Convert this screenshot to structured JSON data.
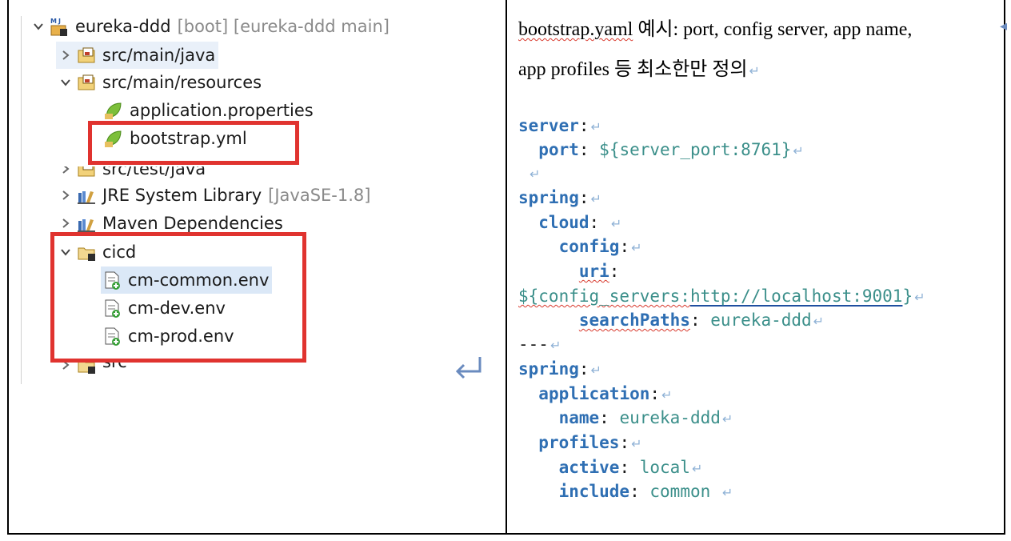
{
  "tree": {
    "items": [
      {
        "label": "eureka-ddd",
        "suffix": "[boot] [eureka-ddd main]",
        "expanded": true
      },
      {
        "label": "src/main/java",
        "expanded": false
      },
      {
        "label": "src/main/resources",
        "expanded": true
      },
      {
        "label": "application.properties"
      },
      {
        "label": "bootstrap.yml"
      },
      {
        "label": "src/test/java",
        "expanded": false
      },
      {
        "label": "JRE System Library",
        "suffix": "[JavaSE-1.8]",
        "expanded": false
      },
      {
        "label": "Maven Dependencies",
        "expanded": false
      },
      {
        "label": "cicd",
        "expanded": true
      },
      {
        "label": "cm-common.env",
        "selected": true
      },
      {
        "label": "cm-dev.env"
      },
      {
        "label": "cm-prod.env"
      },
      {
        "label": "src",
        "expanded": false
      }
    ]
  },
  "doc": {
    "line1_file": "bootstrap.yaml",
    "line1_rest": " 예시: port, config server, app name,",
    "line2": "app profiles 등 최소한만 정의",
    "mark": "↵"
  },
  "code": {
    "k_server": "server",
    "k_port": "port",
    "v_port": "${server_port:8761}",
    "k_spring": "spring",
    "k_cloud": "cloud",
    "k_config": "config",
    "k_uri": "uri",
    "v_uri_prefix": "${config_servers:",
    "v_uri_link": "http://localhost:9001",
    "v_uri_suffix": "}",
    "k_searchpaths": "searchPaths",
    "v_searchpaths": "eureka-ddd",
    "separator": "---",
    "k_spring2": "spring",
    "k_application": "application",
    "k_name": "name",
    "v_name": "eureka-ddd",
    "k_profiles": "profiles",
    "k_active": "active",
    "v_active": "local",
    "k_include": "include",
    "v_include": "common"
  },
  "colors": {
    "highlight_box": "#e0332f",
    "yaml_key": "#2f6fb3",
    "yaml_value": "#3b8f8a",
    "selection": "#dbe8f7"
  }
}
